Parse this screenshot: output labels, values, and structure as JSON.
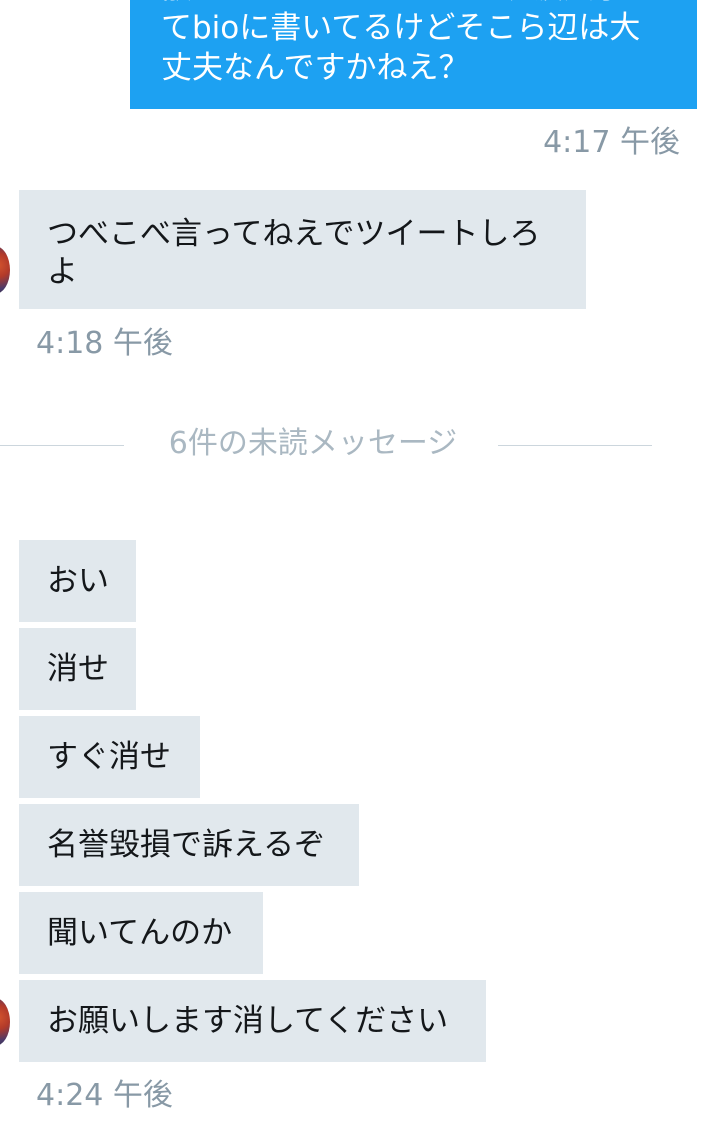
{
  "outgoing": {
    "lines": [
      "散々ツイートしてるし、筑波大学って",
      "てbioに書いてるけどそこら辺は大",
      "丈夫なんですかねえ？"
    ],
    "timestamp": "4:17 午後",
    "color": "#1da1f2"
  },
  "incoming_first": {
    "lines": [
      "つべこべ言ってねえでツイートしろ",
      "よ"
    ],
    "timestamp": "4:18 午後"
  },
  "unread_divider": "6件の未読メッセージ",
  "incoming_group": {
    "messages": [
      "おい",
      "消せ",
      "すぐ消せ",
      "名誉毀損で訴えるぞ",
      "聞いてんのか",
      "お願いします消してください"
    ],
    "timestamp": "4:24 午後"
  },
  "colors": {
    "incoming_bubble": "#e1e8ed",
    "timestamp": "#8899a6",
    "divider_text": "#aab8c2"
  }
}
